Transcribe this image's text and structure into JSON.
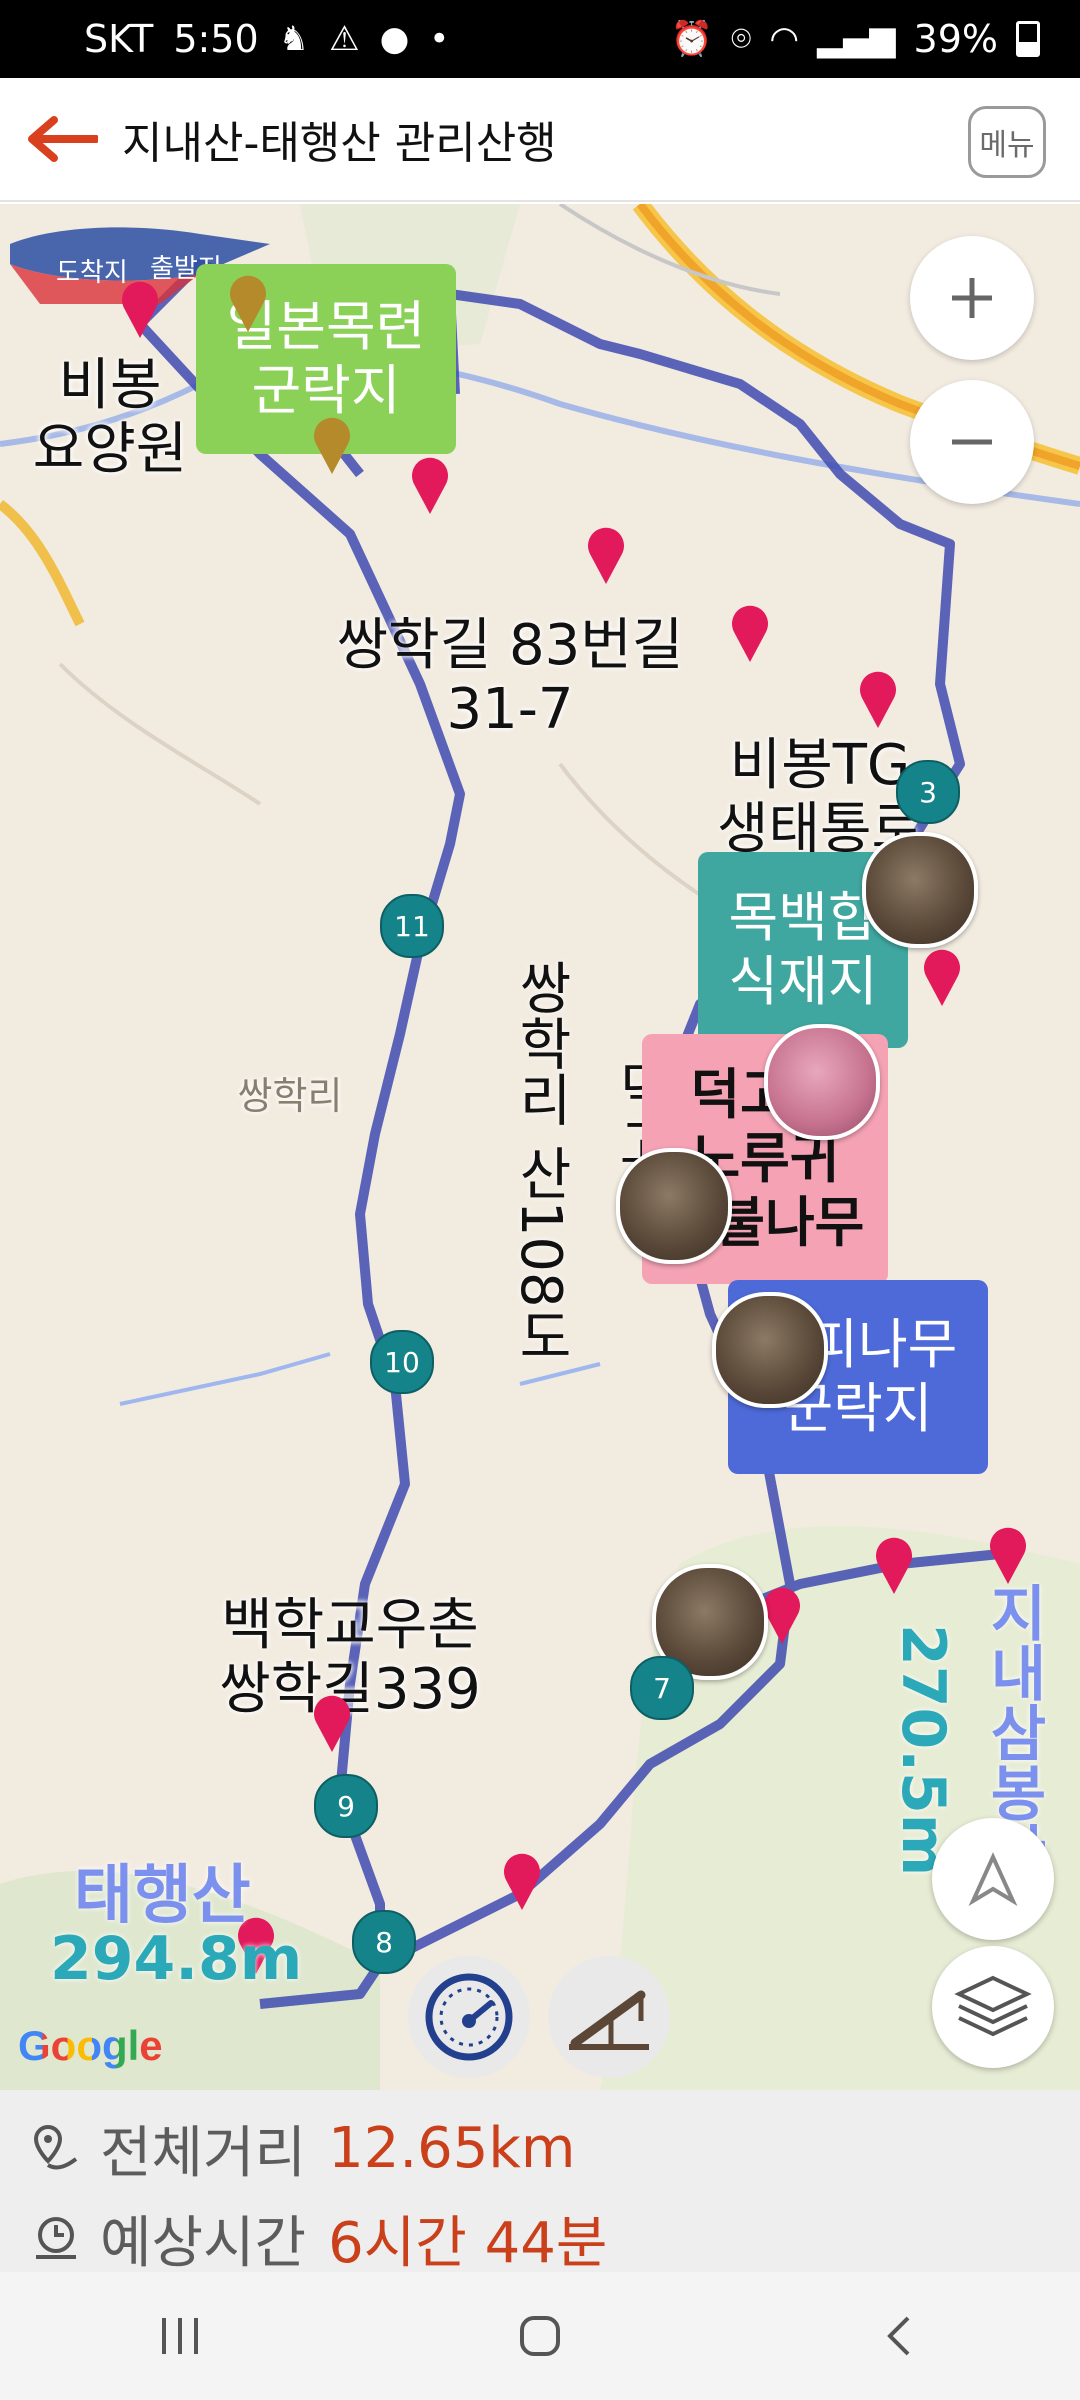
{
  "status_bar": {
    "carrier": "SKT",
    "time": "5:50",
    "battery": "39%",
    "icons_left": [
      "hiking-icon",
      "warning-icon",
      "talk-icon",
      "dot-icon"
    ],
    "icons_right": [
      "alarm-icon",
      "location-icon",
      "wifi-icon",
      "signal-icon",
      "battery-icon"
    ]
  },
  "header": {
    "title": "지내산-태행산 관리산행",
    "menu_label": "메뉴"
  },
  "map": {
    "start_flag": "출발지",
    "end_flag": "도착지",
    "labels": {
      "bibong_hospital": "비봉\n요양원",
      "ssanghak_83": "쌍학길 83번길\n31-7",
      "bibong_tg": "비봉TG\n생태통로",
      "ssanghak_ri": "쌍학리",
      "ssanghak_san": "쌍학리 산108도",
      "deokgogae": "덕고개",
      "baekhak": "백학교우촌\n쌍학길339"
    },
    "boxes": {
      "magnolia": "일본목련\n군락지",
      "mokbaekhap": "목백합\n식재지",
      "deokgogae_box": "덕고개\n노루귀\n괴불나무",
      "gulpi": "굴피나무\n군락지"
    },
    "waypoints": [
      "3",
      "7",
      "8",
      "9",
      "10",
      "11"
    ],
    "peaks": [
      {
        "name": "태행산",
        "elevation": "294.8m"
      },
      {
        "name": "지내삼봉산",
        "elevation": "270.5m"
      }
    ],
    "attribution": "Google",
    "colors": {
      "route": "#3f4bb0",
      "pin": "#e2195b",
      "waypoint": "#15838a",
      "magnolia": "#8bd158",
      "mokbaekhap": "#3fa79f",
      "deokgogae": "#f4a2b4",
      "gulpi": "#4e6ad8"
    }
  },
  "summary": {
    "distance_label": "전체거리",
    "distance_value": "12.65km",
    "time_label": "예상시간",
    "time_value": "6시간 44분"
  }
}
